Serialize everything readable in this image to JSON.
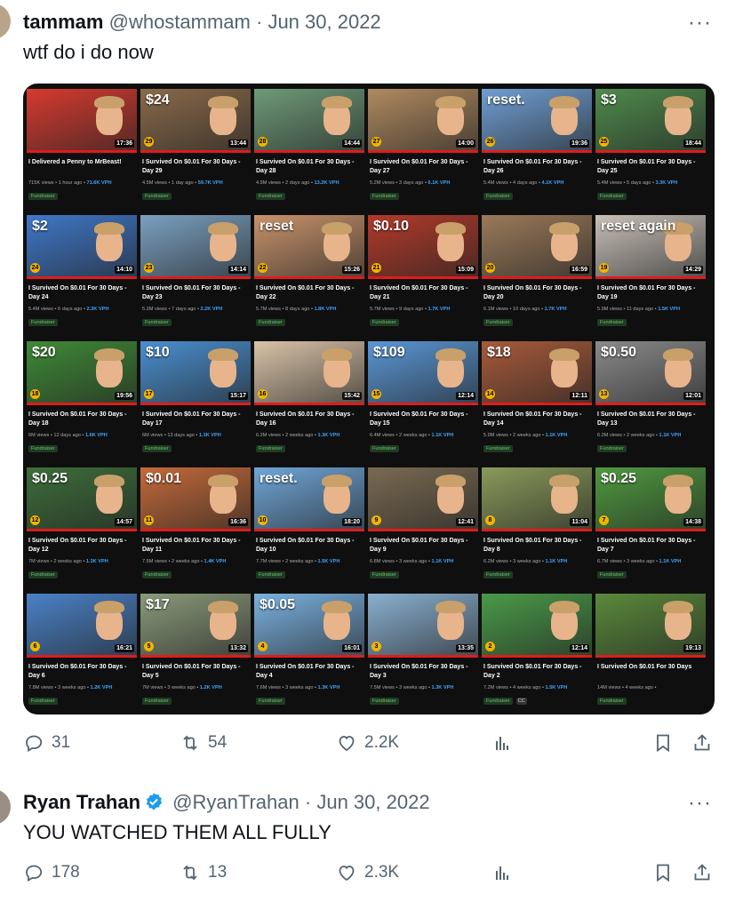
{
  "tweet1": {
    "name": "tammam",
    "handle": "@whostammam",
    "date": "· Jun 30, 2022",
    "text": "wtf do i do now",
    "replies": "31",
    "retweets": "54",
    "likes": "2.2K",
    "more": "···"
  },
  "videos": [
    {
      "overlay": "",
      "badge": "",
      "dur": "17:36",
      "title": "I Delivered a Penny to MrBeast!",
      "stats": "715K views • 1 hour ago •",
      "vph": "71.6K VPH",
      "thumb": "#d63a2f"
    },
    {
      "overlay": "$24",
      "badge": "29",
      "dur": "13:44",
      "title": "I Survived On $0.01 For 30 Days - Day 29",
      "stats": "4.5M views • 1 day ago •",
      "vph": "59.7K VPH",
      "thumb": "#8a6a4a"
    },
    {
      "overlay": "",
      "badge": "28",
      "dur": "14:44",
      "title": "I Survived On $0.01 For 30 Days - Day 28",
      "stats": "4.9M views • 2 days ago •",
      "vph": "13.2K VPH",
      "thumb": "#6e9a78"
    },
    {
      "overlay": "",
      "badge": "27",
      "dur": "14:00",
      "title": "I Survived On $0.01 For 30 Days - Day 27",
      "stats": "5.2M views • 3 days ago •",
      "vph": "6.1K VPH",
      "thumb": "#b08a60"
    },
    {
      "overlay": "reset.",
      "badge": "26",
      "dur": "19:36",
      "title": "I Survived On $0.01 For 30 Days - Day 26",
      "stats": "5.4M views • 4 days ago •",
      "vph": "4.1K VPH",
      "thumb": "#6f9fd3"
    },
    {
      "overlay": "$3",
      "badge": "25",
      "dur": "18:44",
      "title": "I Survived On $0.01 For 30 Days - Day 25",
      "stats": "5.4M views • 5 days ago •",
      "vph": "3.3K VPH",
      "thumb": "#4f8a4c"
    },
    {
      "overlay": "$2",
      "badge": "24",
      "dur": "14:10",
      "title": "I Survived On $0.01 For 30 Days - Day 24",
      "stats": "5.4M views • 6 days ago •",
      "vph": "2.3K VPH",
      "thumb": "#3f78c9"
    },
    {
      "overlay": "",
      "badge": "23",
      "dur": "14:14",
      "title": "I Survived On $0.01 For 30 Days - Day 23",
      "stats": "5.2M views • 7 days ago •",
      "vph": "2.2K VPH",
      "thumb": "#7aa0c0"
    },
    {
      "overlay": "reset",
      "badge": "22",
      "dur": "15:26",
      "title": "I Survived On $0.01 For 30 Days - Day 22",
      "stats": "5.7M views • 8 days ago •",
      "vph": "1.8K VPH",
      "thumb": "#c9936b"
    },
    {
      "overlay": "$0.10",
      "badge": "21",
      "dur": "15:09",
      "title": "I Survived On $0.01 For 30 Days - Day 21",
      "stats": "5.7M views • 9 days ago •",
      "vph": "1.7K VPH",
      "thumb": "#b23a2a"
    },
    {
      "overlay": "",
      "badge": "20",
      "dur": "16:59",
      "title": "I Survived On $0.01 For 30 Days - Day 20",
      "stats": "6.1M views • 10 days ago •",
      "vph": "1.7K VPH",
      "thumb": "#9a7a5a"
    },
    {
      "overlay": "reset again",
      "badge": "19",
      "dur": "14:29",
      "title": "I Survived On $0.01 For 30 Days - Day 19",
      "stats": "5.9M views • 11 days ago •",
      "vph": "1.5K VPH",
      "thumb": "#c8c0b8"
    },
    {
      "overlay": "$20",
      "badge": "18",
      "dur": "19:56",
      "title": "I Survived On $0.01 For 30 Days - Day 18",
      "stats": "6M views • 12 days ago •",
      "vph": "1.6K VPH",
      "thumb": "#3f8a36"
    },
    {
      "overlay": "$10",
      "badge": "17",
      "dur": "15:17",
      "title": "I Survived On $0.01 For 30 Days - Day 17",
      "stats": "6M views • 13 days ago •",
      "vph": "1.3K VPH",
      "thumb": "#4a8fd0"
    },
    {
      "overlay": "",
      "badge": "16",
      "dur": "15:42",
      "title": "I Survived On $0.01 For 30 Days - Day 16",
      "stats": "6.2M views • 2 weeks ago •",
      "vph": "1.3K VPH",
      "thumb": "#d9c3a8"
    },
    {
      "overlay": "$109",
      "badge": "15",
      "dur": "12:14",
      "title": "I Survived On $0.01 For 30 Days - Day 15",
      "stats": "6.4M views • 2 weeks ago •",
      "vph": "1.1K VPH",
      "thumb": "#5a97d6"
    },
    {
      "overlay": "$18",
      "badge": "14",
      "dur": "12:11",
      "title": "I Survived On $0.01 For 30 Days - Day 14",
      "stats": "5.9M views • 2 weeks ago •",
      "vph": "1.1K VPH",
      "thumb": "#a85a3a"
    },
    {
      "overlay": "$0.50",
      "badge": "13",
      "dur": "12:01",
      "title": "I Survived On $0.01 For 30 Days - Day 13",
      "stats": "6.2M views • 2 weeks ago •",
      "vph": "1.1K VPH",
      "thumb": "#8a8a8a"
    },
    {
      "overlay": "$0.25",
      "badge": "12",
      "dur": "14:57",
      "title": "I Survived On $0.01 For 30 Days - Day 12",
      "stats": "7M views • 2 weeks ago •",
      "vph": "1.3K VPH",
      "thumb": "#3d6e3a"
    },
    {
      "overlay": "$0.01",
      "badge": "11",
      "dur": "16:36",
      "title": "I Survived On $0.01 For 30 Days - Day 11",
      "stats": "7.5M views • 2 weeks ago •",
      "vph": "1.4K VPH",
      "thumb": "#c56a3a"
    },
    {
      "overlay": "reset.",
      "badge": "10",
      "dur": "18:20",
      "title": "I Survived On $0.01 For 30 Days - Day 10",
      "stats": "7.7M views • 2 weeks ago •",
      "vph": "1.5K VPH",
      "thumb": "#6fa6d8"
    },
    {
      "overlay": "",
      "badge": "9",
      "dur": "12:41",
      "title": "I Survived On $0.01 For 30 Days - Day 9",
      "stats": "6.8M views • 3 weeks ago •",
      "vph": "1.1K VPH",
      "thumb": "#7a6a52"
    },
    {
      "overlay": "",
      "badge": "8",
      "dur": "11:04",
      "title": "I Survived On $0.01 For 30 Days - Day 8",
      "stats": "6.2M views • 3 weeks ago •",
      "vph": "1.1K VPH",
      "thumb": "#8a9a5a"
    },
    {
      "overlay": "$0.25",
      "badge": "7",
      "dur": "14:38",
      "title": "I Survived On $0.01 For 30 Days - Day 7",
      "stats": "6.7M views • 3 weeks ago •",
      "vph": "1.1K VPH",
      "thumb": "#4f9a3f"
    },
    {
      "overlay": "",
      "badge": "6",
      "dur": "16:21",
      "title": "I Survived On $0.01 For 30 Days - Day 6",
      "stats": "7.8M views • 3 weeks ago •",
      "vph": "1.2K VPH",
      "thumb": "#4a82c8"
    },
    {
      "overlay": "$17",
      "badge": "5",
      "dur": "13:32",
      "title": "I Survived On $0.01 For 30 Days - Day 5",
      "stats": "7M views • 3 weeks ago •",
      "vph": "1.2K VPH",
      "thumb": "#8a9a7a"
    },
    {
      "overlay": "$0.05",
      "badge": "4",
      "dur": "16:01",
      "title": "I Survived On $0.01 For 30 Days - Day 4",
      "stats": "7.6M views • 3 weeks ago •",
      "vph": "1.3K VPH",
      "thumb": "#7ab2e0"
    },
    {
      "overlay": "",
      "badge": "3",
      "dur": "13:35",
      "title": "I Survived On $0.01 For 30 Days - Day 3",
      "stats": "7.5M views • 3 weeks ago •",
      "vph": "1.3K VPH",
      "thumb": "#8ab0d0"
    },
    {
      "overlay": "",
      "badge": "2",
      "dur": "12:14",
      "title": "I Survived On $0.01 For 30 Days - Day 2",
      "stats": "7.2M views • 4 weeks ago •",
      "vph": "1.5K VPH",
      "thumb": "#4a9a48"
    },
    {
      "overlay": "",
      "badge": "",
      "dur": "19:13",
      "title": "I Survived On $0.01 For 30 Days",
      "stats": "14M views • 4 weeks ago •",
      "vph": "",
      "thumb": "#5a8a3a"
    }
  ],
  "fundraiser_label": "Fundraiser",
  "cc_label": "CC",
  "tweet2": {
    "name": "Ryan Trahan",
    "handle": "@RyanTrahan",
    "date": "· Jun 30, 2022",
    "text": "YOU WATCHED THEM ALL FULLY",
    "replies": "178",
    "retweets": "13",
    "likes": "2.3K",
    "more": "···"
  },
  "colors": {
    "verified_blue": "#1d9bf0",
    "action_gray": "#536471",
    "fundraiser_green": "#6cc070",
    "vph_blue": "#3ea6ff",
    "progress_red": "#e01b1b"
  }
}
